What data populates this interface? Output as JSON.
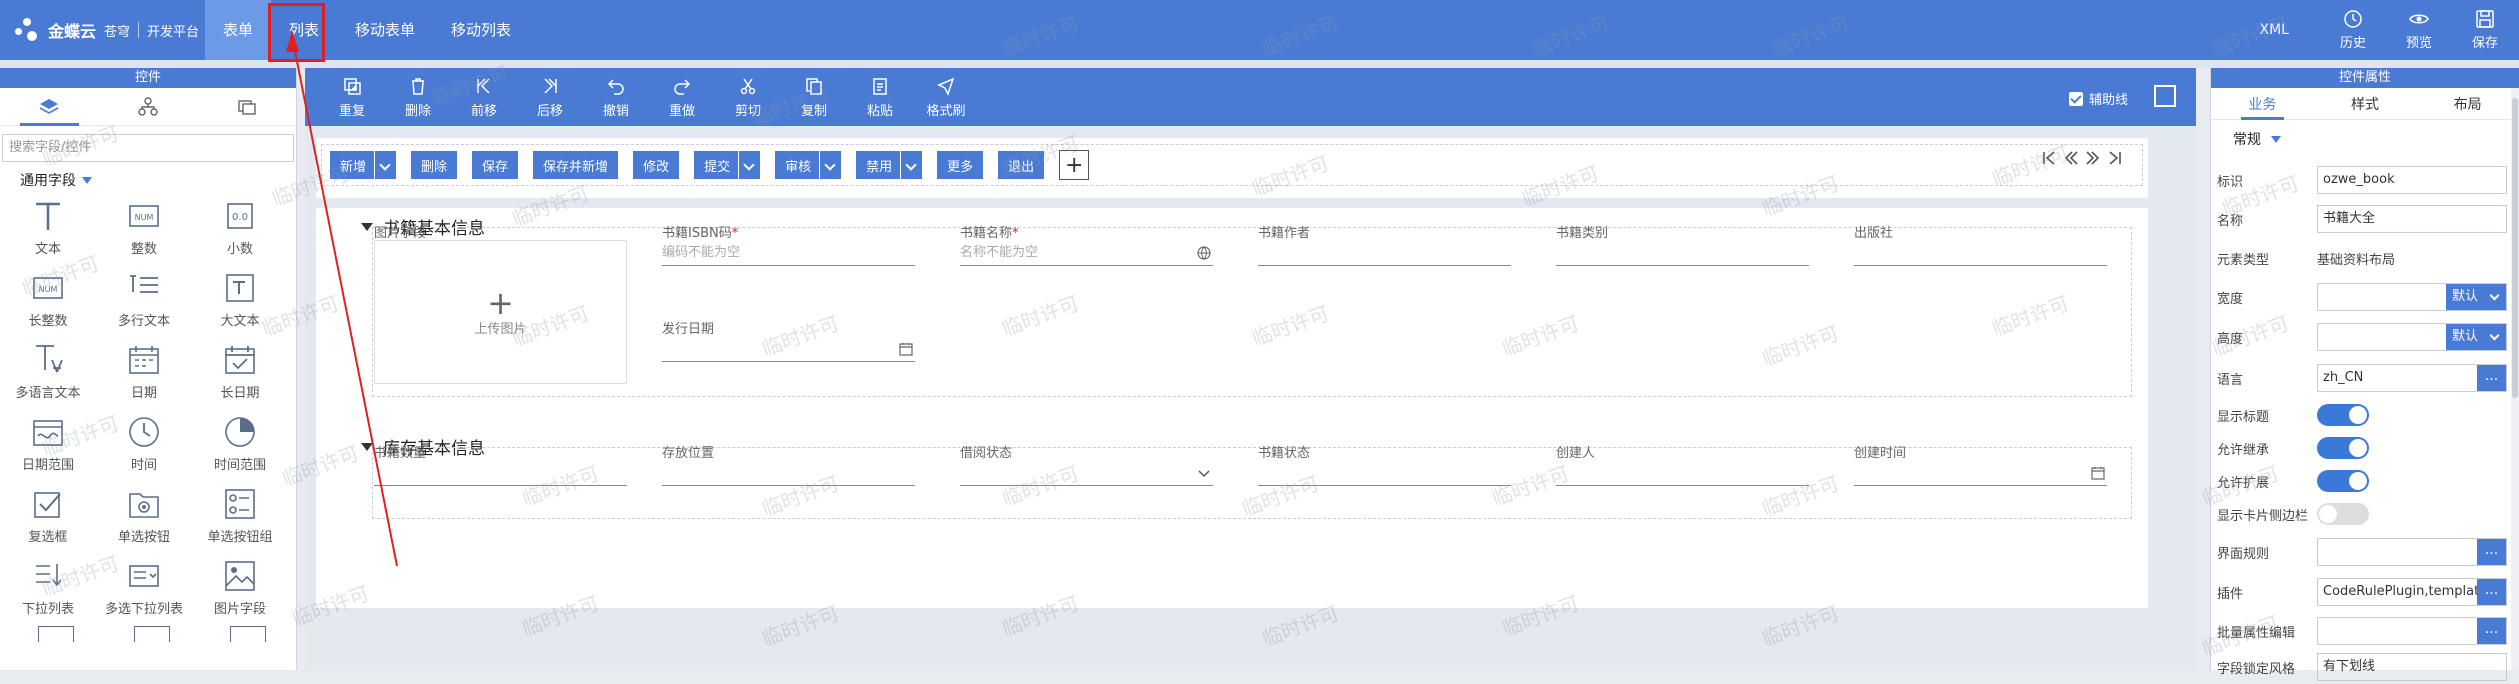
{
  "header": {
    "brand": "金蝶云",
    "brand_sub": "苍穹",
    "platform": "开发平台",
    "nav": [
      {
        "label": "表单",
        "active": true
      },
      {
        "label": "列表",
        "active": false
      },
      {
        "label": "移动表单",
        "active": false
      },
      {
        "label": "移动列表",
        "active": false
      }
    ],
    "xml": "XML",
    "actions": [
      {
        "label": "历史",
        "icon": "history-icon"
      },
      {
        "label": "预览",
        "icon": "eye-icon"
      },
      {
        "label": "保存",
        "icon": "save-icon"
      }
    ]
  },
  "left_panel": {
    "title": "控件",
    "search_placeholder": "搜索字段/控件",
    "group": "通用字段",
    "items": [
      "文本",
      "整数",
      "小数",
      "长整数",
      "多行文本",
      "大文本",
      "多语言文本",
      "日期",
      "长日期",
      "日期范围",
      "时间",
      "时间范围",
      "复选框",
      "单选按钮",
      "单选按钮组",
      "下拉列表",
      "多选下拉列表",
      "图片字段"
    ]
  },
  "toolbar": [
    "重复",
    "删除",
    "前移",
    "后移",
    "撤销",
    "重做",
    "剪切",
    "复制",
    "粘贴",
    "格式刷"
  ],
  "aux_line": "辅助线",
  "action_buttons": [
    {
      "label": "新增",
      "split": true
    },
    {
      "label": "删除",
      "split": false
    },
    {
      "label": "保存",
      "split": false
    },
    {
      "label": "保存并新增",
      "split": false
    },
    {
      "label": "修改",
      "split": false
    },
    {
      "label": "提交",
      "split": true
    },
    {
      "label": "审核",
      "split": true
    },
    {
      "label": "禁用",
      "split": true
    },
    {
      "label": "更多",
      "split": false
    },
    {
      "label": "退出",
      "split": false
    }
  ],
  "sections": [
    {
      "title": "书籍基本信息",
      "image_field": {
        "label": "图片字段",
        "upload": "上传图片"
      },
      "fields": [
        {
          "label": "书籍ISBN码",
          "required": true,
          "placeholder": "编码不能为空",
          "icon": ""
        },
        {
          "label": "书籍名称",
          "required": true,
          "placeholder": "名称不能为空",
          "icon": "globe-icon"
        },
        {
          "label": "书籍作者",
          "required": false,
          "placeholder": "",
          "icon": ""
        },
        {
          "label": "书籍类别",
          "required": false,
          "placeholder": "",
          "icon": ""
        },
        {
          "label": "出版社",
          "required": false,
          "placeholder": "",
          "icon": ""
        },
        {
          "label": "发行日期",
          "required": false,
          "placeholder": "",
          "icon": "calendar-icon"
        }
      ]
    },
    {
      "title": "库存基本信息",
      "fields": [
        {
          "label": "书籍数量",
          "icon": ""
        },
        {
          "label": "存放位置",
          "icon": ""
        },
        {
          "label": "借阅状态",
          "icon": "chevron-down-icon"
        },
        {
          "label": "书籍状态",
          "icon": ""
        },
        {
          "label": "创建人",
          "icon": ""
        },
        {
          "label": "创建时间",
          "icon": "calendar-icon"
        }
      ]
    }
  ],
  "right_panel": {
    "title": "控件属性",
    "tabs": [
      "业务",
      "样式",
      "布局"
    ],
    "group": "常规",
    "props": [
      {
        "label": "标识",
        "value": "ozwe_book",
        "kind": "input"
      },
      {
        "label": "名称",
        "value": "书籍大全",
        "kind": "input"
      },
      {
        "label": "元素类型",
        "value": "基础资料布局",
        "kind": "text"
      },
      {
        "label": "宽度",
        "value": "",
        "kind": "select",
        "option": "默认"
      },
      {
        "label": "高度",
        "value": "",
        "kind": "select",
        "option": "默认"
      },
      {
        "label": "语言",
        "value": "zh_CN",
        "kind": "dots"
      },
      {
        "label": "显示标题",
        "value": "on",
        "kind": "toggle"
      },
      {
        "label": "允许继承",
        "value": "on",
        "kind": "toggle"
      },
      {
        "label": "允许扩展",
        "value": "on",
        "kind": "toggle"
      },
      {
        "label": "显示卡片侧边栏",
        "value": "off",
        "kind": "toggle"
      },
      {
        "label": "界面规则",
        "value": "",
        "kind": "dots"
      },
      {
        "label": "插件",
        "value": "CodeRulePlugin,template",
        "kind": "dots"
      },
      {
        "label": "批量属性编辑",
        "value": "",
        "kind": "dots"
      },
      {
        "label": "字段锁定风格",
        "value": "有下划线",
        "kind": "input"
      }
    ]
  },
  "watermark": "临时许可",
  "colors": {
    "primary": "#4a7bd4",
    "highlight": "#e02020"
  }
}
